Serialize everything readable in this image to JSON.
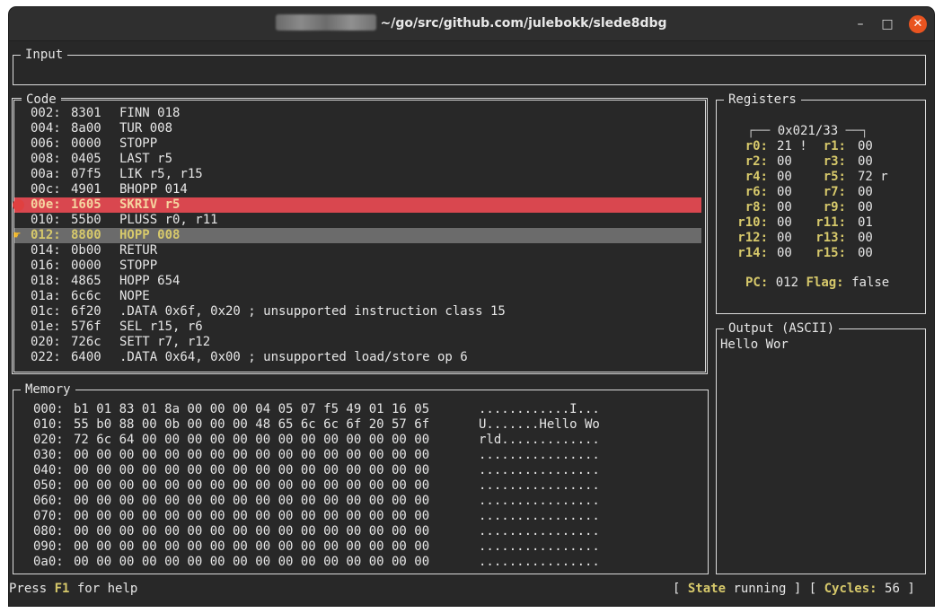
{
  "window": {
    "title": "~/go/src/github.com/julebokk/slede8dbg",
    "min_glyph": "–",
    "max_glyph": "□",
    "close_glyph": "✕"
  },
  "input": {
    "title": "Input",
    "value": ""
  },
  "code": {
    "title": "Code",
    "lines": [
      {
        "addr": "002:",
        "hex": "8301",
        "asm": "FINN 018",
        "state": ""
      },
      {
        "addr": "004:",
        "hex": "8a00",
        "asm": "TUR 008",
        "state": ""
      },
      {
        "addr": "006:",
        "hex": "0000",
        "asm": "STOPP",
        "state": ""
      },
      {
        "addr": "008:",
        "hex": "0405",
        "asm": "LAST r5",
        "state": ""
      },
      {
        "addr": "00a:",
        "hex": "07f5",
        "asm": "LIK r5, r15",
        "state": ""
      },
      {
        "addr": "00c:",
        "hex": "4901",
        "asm": "BHOPP 014",
        "state": ""
      },
      {
        "addr": "00e:",
        "hex": "1605",
        "asm": "SKRIV r5",
        "state": "breakpoint"
      },
      {
        "addr": "010:",
        "hex": "55b0",
        "asm": "PLUSS r0, r11",
        "state": ""
      },
      {
        "addr": "012:",
        "hex": "8800",
        "asm": "HOPP 008",
        "state": "current"
      },
      {
        "addr": "014:",
        "hex": "0b00",
        "asm": "RETUR",
        "state": ""
      },
      {
        "addr": "016:",
        "hex": "0000",
        "asm": "STOPP",
        "state": ""
      },
      {
        "addr": "018:",
        "hex": "4865",
        "asm": "HOPP 654",
        "state": ""
      },
      {
        "addr": "01a:",
        "hex": "6c6c",
        "asm": "NOPE",
        "state": ""
      },
      {
        "addr": "01c:",
        "hex": "6f20",
        "asm": ".DATA 0x6f, 0x20 ; unsupported instruction class 15",
        "state": ""
      },
      {
        "addr": "01e:",
        "hex": "576f",
        "asm": "SEL r15, r6",
        "state": ""
      },
      {
        "addr": "020:",
        "hex": "726c",
        "asm": "SETT r7, r12",
        "state": ""
      },
      {
        "addr": "022:",
        "hex": "6400",
        "asm": ".DATA 0x64, 0x00 ; unsupported load/store op 6",
        "state": ""
      }
    ]
  },
  "memory": {
    "title": "Memory",
    "rows": [
      {
        "addr": "000:",
        "bytes": "b1 01 83 01 8a 00 00 00 04 05 07 f5 49 01 16 05",
        "ascii": "............I..."
      },
      {
        "addr": "010:",
        "bytes": "55 b0 88 00 0b 00 00 00 48 65 6c 6c 6f 20 57 6f",
        "ascii": "U.......Hello Wo"
      },
      {
        "addr": "020:",
        "bytes": "72 6c 64 00 00 00 00 00 00 00 00 00 00 00 00 00",
        "ascii": "rld............."
      },
      {
        "addr": "030:",
        "bytes": "00 00 00 00 00 00 00 00 00 00 00 00 00 00 00 00",
        "ascii": "................"
      },
      {
        "addr": "040:",
        "bytes": "00 00 00 00 00 00 00 00 00 00 00 00 00 00 00 00",
        "ascii": "................"
      },
      {
        "addr": "050:",
        "bytes": "00 00 00 00 00 00 00 00 00 00 00 00 00 00 00 00",
        "ascii": "................"
      },
      {
        "addr": "060:",
        "bytes": "00 00 00 00 00 00 00 00 00 00 00 00 00 00 00 00",
        "ascii": "................"
      },
      {
        "addr": "070:",
        "bytes": "00 00 00 00 00 00 00 00 00 00 00 00 00 00 00 00",
        "ascii": "................"
      },
      {
        "addr": "080:",
        "bytes": "00 00 00 00 00 00 00 00 00 00 00 00 00 00 00 00",
        "ascii": "................"
      },
      {
        "addr": "090:",
        "bytes": "00 00 00 00 00 00 00 00 00 00 00 00 00 00 00 00",
        "ascii": "................"
      },
      {
        "addr": "0a0:",
        "bytes": "00 00 00 00 00 00 00 00 00 00 00 00 00 00 00 00",
        "ascii": "................"
      }
    ]
  },
  "registers": {
    "title": "Registers",
    "header": "0x021/33",
    "pairs": [
      [
        {
          "name": "r0:",
          "value": "21 !"
        },
        {
          "name": "r1:",
          "value": "00"
        }
      ],
      [
        {
          "name": "r2:",
          "value": "00"
        },
        {
          "name": "r3:",
          "value": "00"
        }
      ],
      [
        {
          "name": "r4:",
          "value": "00"
        },
        {
          "name": "r5:",
          "value": "72 r"
        }
      ],
      [
        {
          "name": "r6:",
          "value": "00"
        },
        {
          "name": "r7:",
          "value": "00"
        }
      ],
      [
        {
          "name": "r8:",
          "value": "00"
        },
        {
          "name": "r9:",
          "value": "00"
        }
      ],
      [
        {
          "name": "r10:",
          "value": "00"
        },
        {
          "name": "r11:",
          "value": "01"
        }
      ],
      [
        {
          "name": "r12:",
          "value": "00"
        },
        {
          "name": "r13:",
          "value": "00"
        }
      ],
      [
        {
          "name": "r14:",
          "value": "00"
        },
        {
          "name": "r15:",
          "value": "00"
        }
      ]
    ],
    "pc_label": "PC:",
    "pc_value": "012",
    "flag_label": "Flag:",
    "flag_value": "false"
  },
  "output": {
    "title": "Output (ASCII)",
    "text": "Hello Wor"
  },
  "statusbar": {
    "help_prefix": "Press ",
    "help_key": "F1",
    "help_suffix": " for help",
    "bracket_open": "[ ",
    "state_label": "State",
    "state_value": " running ] [ ",
    "cycles_label": "Cycles:",
    "cycles_value": " 56 ]"
  },
  "colors": {
    "background": "#282828",
    "breakpoint": "#d9474f",
    "current_line": "#6b6b6b",
    "keyword": "#d7c96b"
  }
}
